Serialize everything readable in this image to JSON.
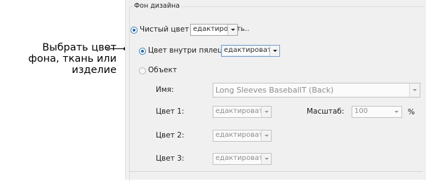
{
  "callout": {
    "lines": [
      "Выбрать цвет",
      "фона, ткань или",
      "изделие"
    ]
  },
  "dialog": {
    "group_title": "Фон дизайна",
    "solid_color": {
      "label": "Чистый цвет",
      "selected": true,
      "combo_value": "едактировать.."
    },
    "inside_color": {
      "label": "Цвет внутри пялец:",
      "selected": true,
      "combo_value": "едактировать.."
    },
    "object": {
      "label": "Объект",
      "selected": false,
      "name_label": "Имя:",
      "name_value": "Long Sleeves BaseballT (Back)",
      "color1_label": "Цвет 1:",
      "color1_value": "едактировать..",
      "scale_label": "Масштаб:",
      "scale_value": "100",
      "scale_unit": "%",
      "color2_label": "Цвет 2:",
      "color2_value": "едактировать..",
      "color3_label": "Цвет 3:",
      "color3_value": "едактировать.."
    }
  },
  "icons": {
    "dropdown": "chevron-down-icon",
    "radio": "radio-icon"
  }
}
